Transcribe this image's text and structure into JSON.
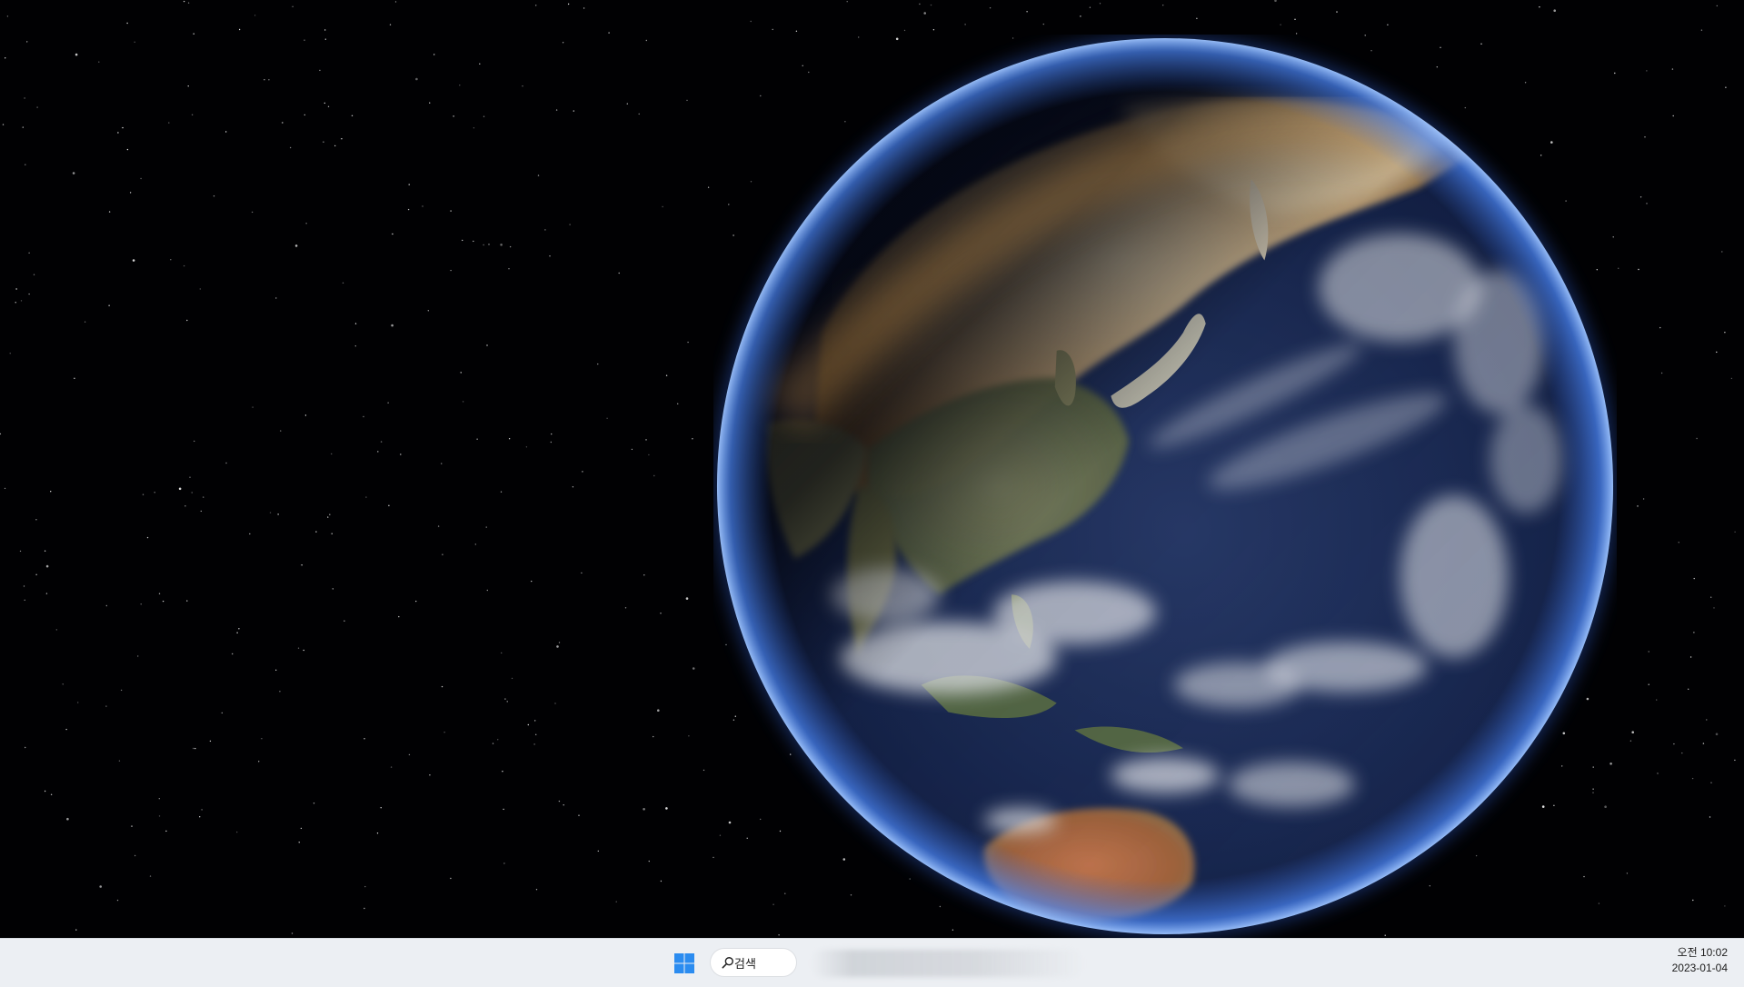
{
  "wallpaper": {
    "subject": "earth-globe",
    "space_color": "#010103",
    "atmosphere_color": "#4d8bff"
  },
  "taskbar": {
    "start_icon": "windows-logo-icon",
    "search": {
      "icon": "search-icon",
      "label": "검색"
    },
    "clock": {
      "time": "오전 10:02",
      "date": "2023-01-04"
    },
    "accent_color": "#2b8cf0"
  }
}
